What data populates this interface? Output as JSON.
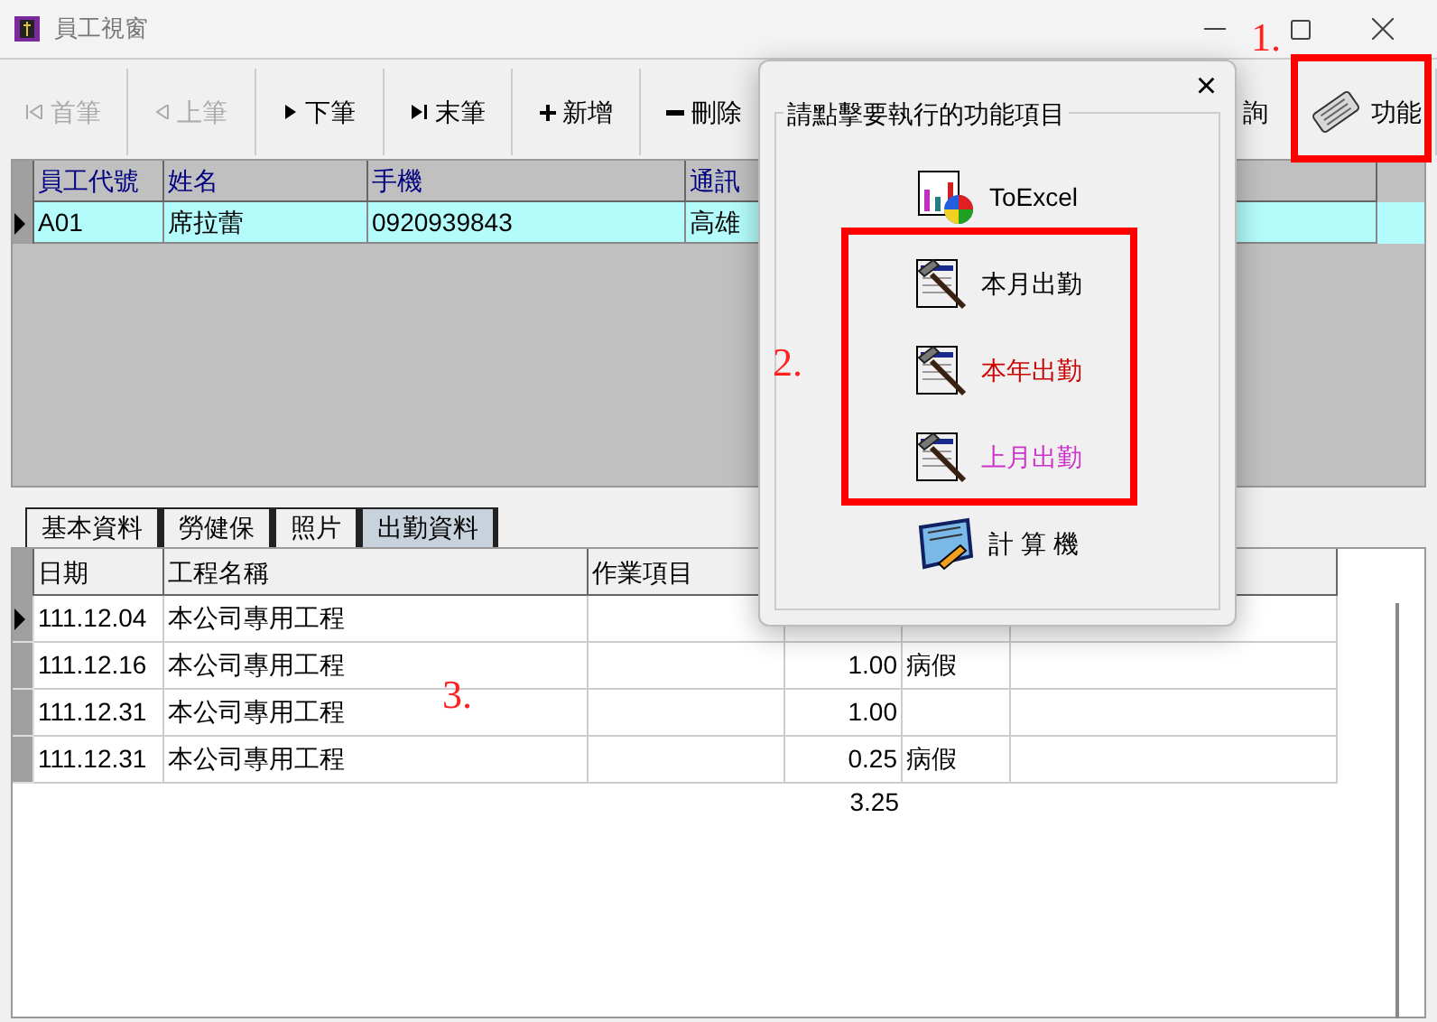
{
  "window": {
    "title": "員工視窗"
  },
  "toolbar": [
    {
      "label": "首筆",
      "kind": "first",
      "disabled": true
    },
    {
      "label": "上筆",
      "kind": "prev",
      "disabled": true
    },
    {
      "label": "下筆",
      "kind": "next",
      "disabled": false
    },
    {
      "label": "末筆",
      "kind": "last",
      "disabled": false
    },
    {
      "label": "新增",
      "kind": "add",
      "disabled": false
    },
    {
      "label": "刪除",
      "kind": "delete",
      "disabled": false
    },
    {
      "label": "詢",
      "kind": "query",
      "disabled": false
    },
    {
      "label": "功能",
      "kind": "function",
      "disabled": false
    }
  ],
  "employee_table": {
    "columns": [
      "員工代號",
      "姓名",
      "手機",
      "通訊"
    ],
    "rows": [
      {
        "selected": true,
        "cells": [
          "A01",
          "席拉蕾",
          "0920939843",
          "高雄"
        ]
      }
    ]
  },
  "tabs": [
    {
      "label": "基本資料",
      "selected": false
    },
    {
      "label": "勞健保",
      "selected": false
    },
    {
      "label": "照片",
      "selected": false
    },
    {
      "label": "出勤資料",
      "selected": true
    }
  ],
  "attendance_table": {
    "columns": [
      "日期",
      "工程名稱",
      "作業項目"
    ],
    "rows": [
      {
        "selected": true,
        "cells": [
          "111.12.04",
          "本公司專用工程"
        ]
      },
      {
        "selected": false,
        "cells": [
          "111.12.16",
          "本公司專用工程",
          "",
          "1.00",
          "病假"
        ]
      },
      {
        "selected": false,
        "cells": [
          "111.12.31",
          "本公司專用工程",
          "",
          "1.00",
          ""
        ]
      },
      {
        "selected": false,
        "cells": [
          "111.12.31",
          "本公司專用工程",
          "",
          "0.25",
          "病假"
        ]
      }
    ],
    "total": "3.25"
  },
  "dialog": {
    "close": "×",
    "title": "請點擊要執行的功能項目",
    "items": [
      {
        "label": "ToExcel",
        "kind": "excel",
        "color": "#000000"
      },
      {
        "label": "本月出勤",
        "kind": "hammer",
        "color": "#000000"
      },
      {
        "label": "本年出勤",
        "kind": "hammer",
        "color": "#cc0000"
      },
      {
        "label": "上月出勤",
        "kind": "hammer",
        "color": "#cc33cc"
      },
      {
        "label": "計 算 機",
        "kind": "calculator",
        "color": "#000000"
      }
    ]
  },
  "annotations": [
    "1.",
    "2.",
    "3."
  ]
}
